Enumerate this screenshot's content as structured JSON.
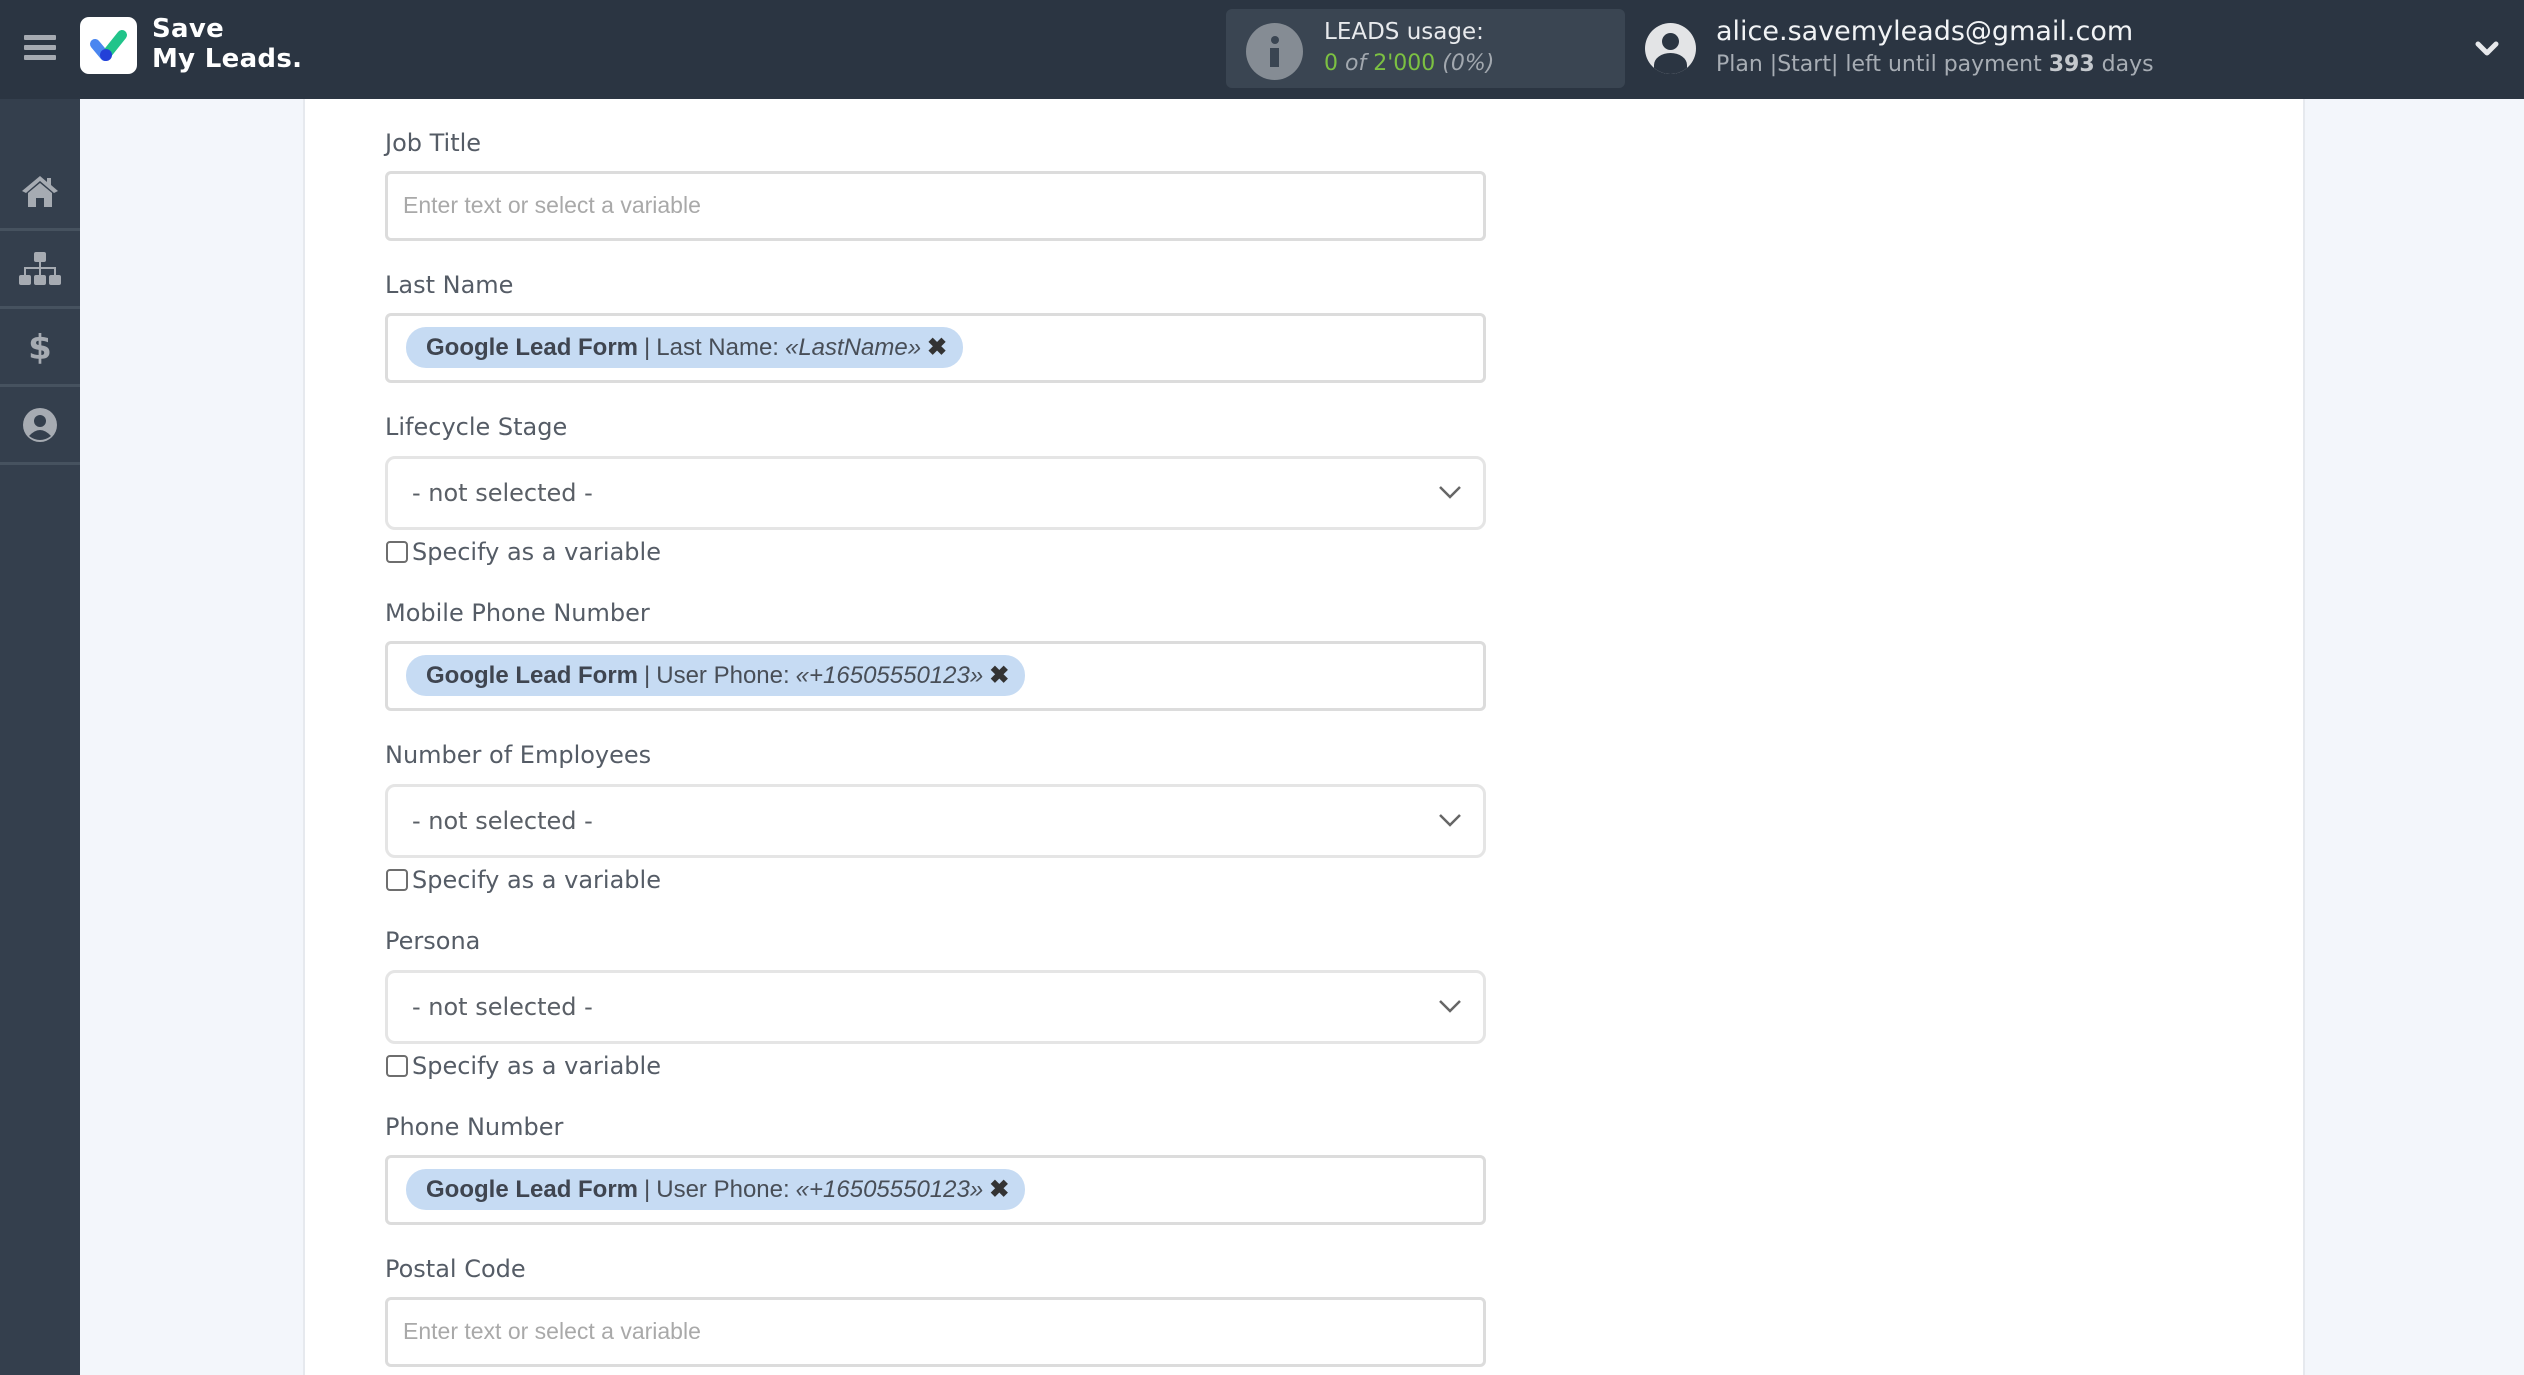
{
  "header": {
    "menu_icon": "hamburger-icon",
    "logo_line1": "Save",
    "logo_line2": "My Leads.",
    "usage": {
      "title": "LEADS usage:",
      "used": "0",
      "of_text": "of",
      "limit": "2'000",
      "percent": "(0%)",
      "icon": "info-icon"
    },
    "user": {
      "email": "alice.savemyleads@gmail.com",
      "plan_prefix": "Plan |Start| left until payment",
      "days": "393",
      "days_suffix": "days",
      "avatar_icon": "user-circle-icon",
      "dropdown_icon": "chevron-down-icon"
    }
  },
  "sidebar": {
    "items": [
      {
        "name": "home",
        "icon": "home-icon"
      },
      {
        "name": "connections",
        "icon": "sitemap-icon"
      },
      {
        "name": "billing",
        "icon": "dollar-icon"
      },
      {
        "name": "account",
        "icon": "user-circle-icon"
      }
    ]
  },
  "form": {
    "fields": [
      {
        "label": "Job Title",
        "type": "text",
        "placeholder": "Enter text or select a variable"
      },
      {
        "label": "Last Name",
        "type": "tag",
        "tag": {
          "source": "Google Lead Form",
          "field": "Last Name:",
          "value": "«LastName»"
        }
      },
      {
        "label": "Lifecycle Stage",
        "type": "select",
        "value": "- not selected -",
        "checkbox_label": "Specify as a variable",
        "checked": false
      },
      {
        "label": "Mobile Phone Number",
        "type": "tag",
        "tag": {
          "source": "Google Lead Form",
          "field": "User Phone:",
          "value": "«+16505550123»"
        }
      },
      {
        "label": "Number of Employees",
        "type": "select",
        "value": "- not selected -",
        "checkbox_label": "Specify as a variable",
        "checked": false
      },
      {
        "label": "Persona",
        "type": "select",
        "value": "- not selected -",
        "checkbox_label": "Specify as a variable",
        "checked": false
      },
      {
        "label": "Phone Number",
        "type": "tag",
        "tag": {
          "source": "Google Lead Form",
          "field": "User Phone:",
          "value": "«+16505550123»"
        }
      },
      {
        "label": "Postal Code",
        "type": "text",
        "placeholder": "Enter text or select a variable"
      }
    ],
    "tag_separator": "|",
    "tag_remove": "✖"
  },
  "colors": {
    "header_bg": "#2b3542",
    "sidebar_bg": "#343f4d",
    "usage_green": "#7cc142",
    "tag_bg": "#c6dbf3",
    "page_bg": "#f3f6fb"
  }
}
